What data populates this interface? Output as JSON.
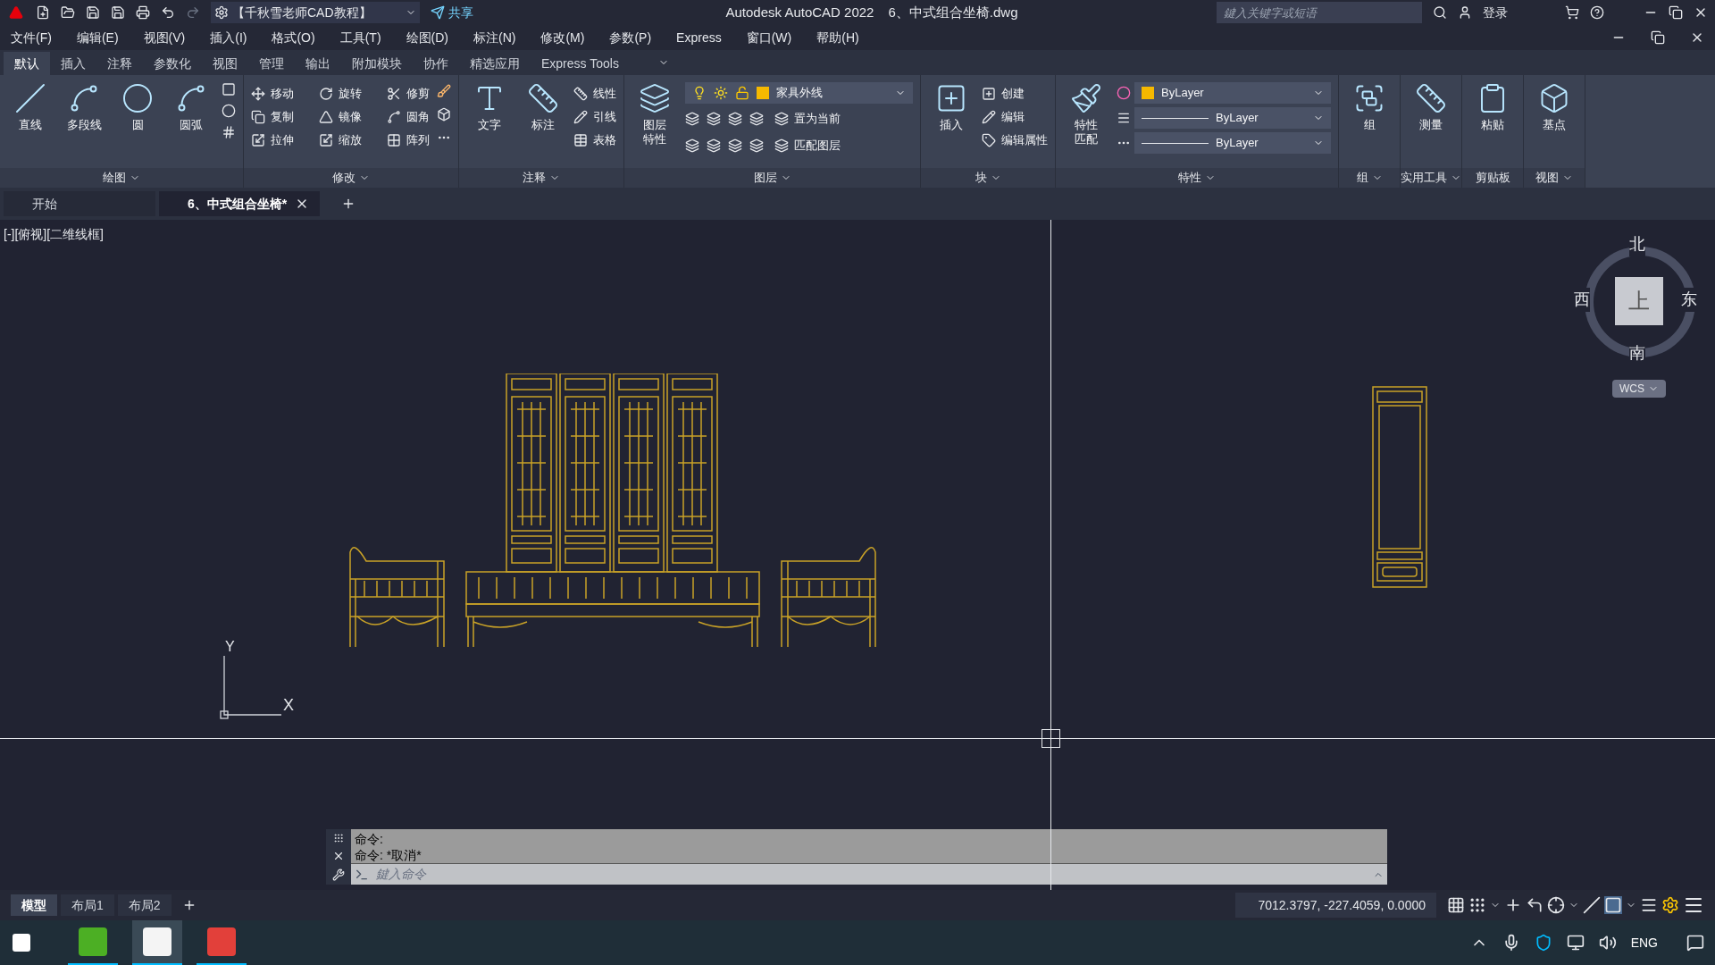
{
  "title_bar": {
    "workspace": "【千秋雪老师CAD教程】",
    "share": "共享",
    "app_title": "Autodesk AutoCAD 2022",
    "file_name": "6、中式组合坐椅.dwg",
    "search_placeholder": "鍵入关键字或短语",
    "login": "登录"
  },
  "menu_bar": [
    "文件(F)",
    "编辑(E)",
    "视图(V)",
    "插入(I)",
    "格式(O)",
    "工具(T)",
    "绘图(D)",
    "标注(N)",
    "修改(M)",
    "参数(P)",
    "Express",
    "窗口(W)",
    "帮助(H)"
  ],
  "ribbon_tabs": [
    {
      "label": "默认",
      "selected": true
    },
    {
      "label": "插入",
      "selected": false
    },
    {
      "label": "注释",
      "selected": false
    },
    {
      "label": "参数化",
      "selected": false
    },
    {
      "label": "视图",
      "selected": false
    },
    {
      "label": "管理",
      "selected": false
    },
    {
      "label": "输出",
      "selected": false
    },
    {
      "label": "附加模块",
      "selected": false
    },
    {
      "label": "协作",
      "selected": false
    },
    {
      "label": "精选应用",
      "selected": false
    },
    {
      "label": "Express Tools",
      "selected": false
    }
  ],
  "ribbon_panels": [
    {
      "title": "绘图",
      "large": [
        "直线",
        "多段线",
        "圆",
        "圆弧"
      ]
    },
    {
      "title": "修改",
      "small": [
        "移动",
        "旋转",
        "修剪",
        "复制",
        "镜像",
        "圆角",
        "拉伸",
        "缩放",
        "阵列"
      ]
    },
    {
      "title": "注释",
      "large": [
        "文字",
        "标注"
      ],
      "small": [
        "线性",
        "引线",
        "表格"
      ]
    },
    {
      "title": "图层",
      "large": [
        "图层特性"
      ],
      "small": [
        "置为当前",
        "匹配图层"
      ],
      "layer": "家具外线"
    },
    {
      "title": "块",
      "large": [
        "插入"
      ],
      "small": [
        "创建",
        "编辑",
        "编辑属性"
      ]
    },
    {
      "title": "特性",
      "large": [
        "特性匹配"
      ],
      "properties": [
        "ByLayer",
        "ByLayer",
        "ByLayer"
      ]
    },
    {
      "title": "组",
      "large": [
        "组"
      ]
    },
    {
      "title": "实用工具",
      "large": [
        "测量"
      ]
    },
    {
      "title": "剪贴板",
      "large": [
        "粘贴"
      ]
    },
    {
      "title": "视图",
      "large": [
        "基点"
      ]
    }
  ],
  "doc_tabs": [
    {
      "label": "开始",
      "selected": false
    },
    {
      "label": "6、中式组合坐椅*",
      "selected": true
    }
  ],
  "viewport": {
    "label": "[-][俯视][二维线框]",
    "viewcube": {
      "north": "北",
      "south": "南",
      "east": "东",
      "west": "西",
      "face": "上",
      "ucs": "WCS"
    },
    "ucs_x": "X",
    "ucs_y": "Y"
  },
  "command_line": {
    "history": [
      "命令:",
      "命令: *取消*"
    ],
    "placeholder": "鍵入命令"
  },
  "layout_tabs": [
    {
      "label": "模型",
      "selected": true
    },
    {
      "label": "布局1",
      "selected": false
    },
    {
      "label": "布局2",
      "selected": false
    }
  ],
  "status_bar": {
    "coordinates": "7012.3797, -227.4059, 0.0000"
  },
  "taskbar": {
    "apps": [
      {
        "selected": false
      },
      {
        "selected": true
      },
      {
        "selected": false
      }
    ],
    "language": "ENG"
  }
}
